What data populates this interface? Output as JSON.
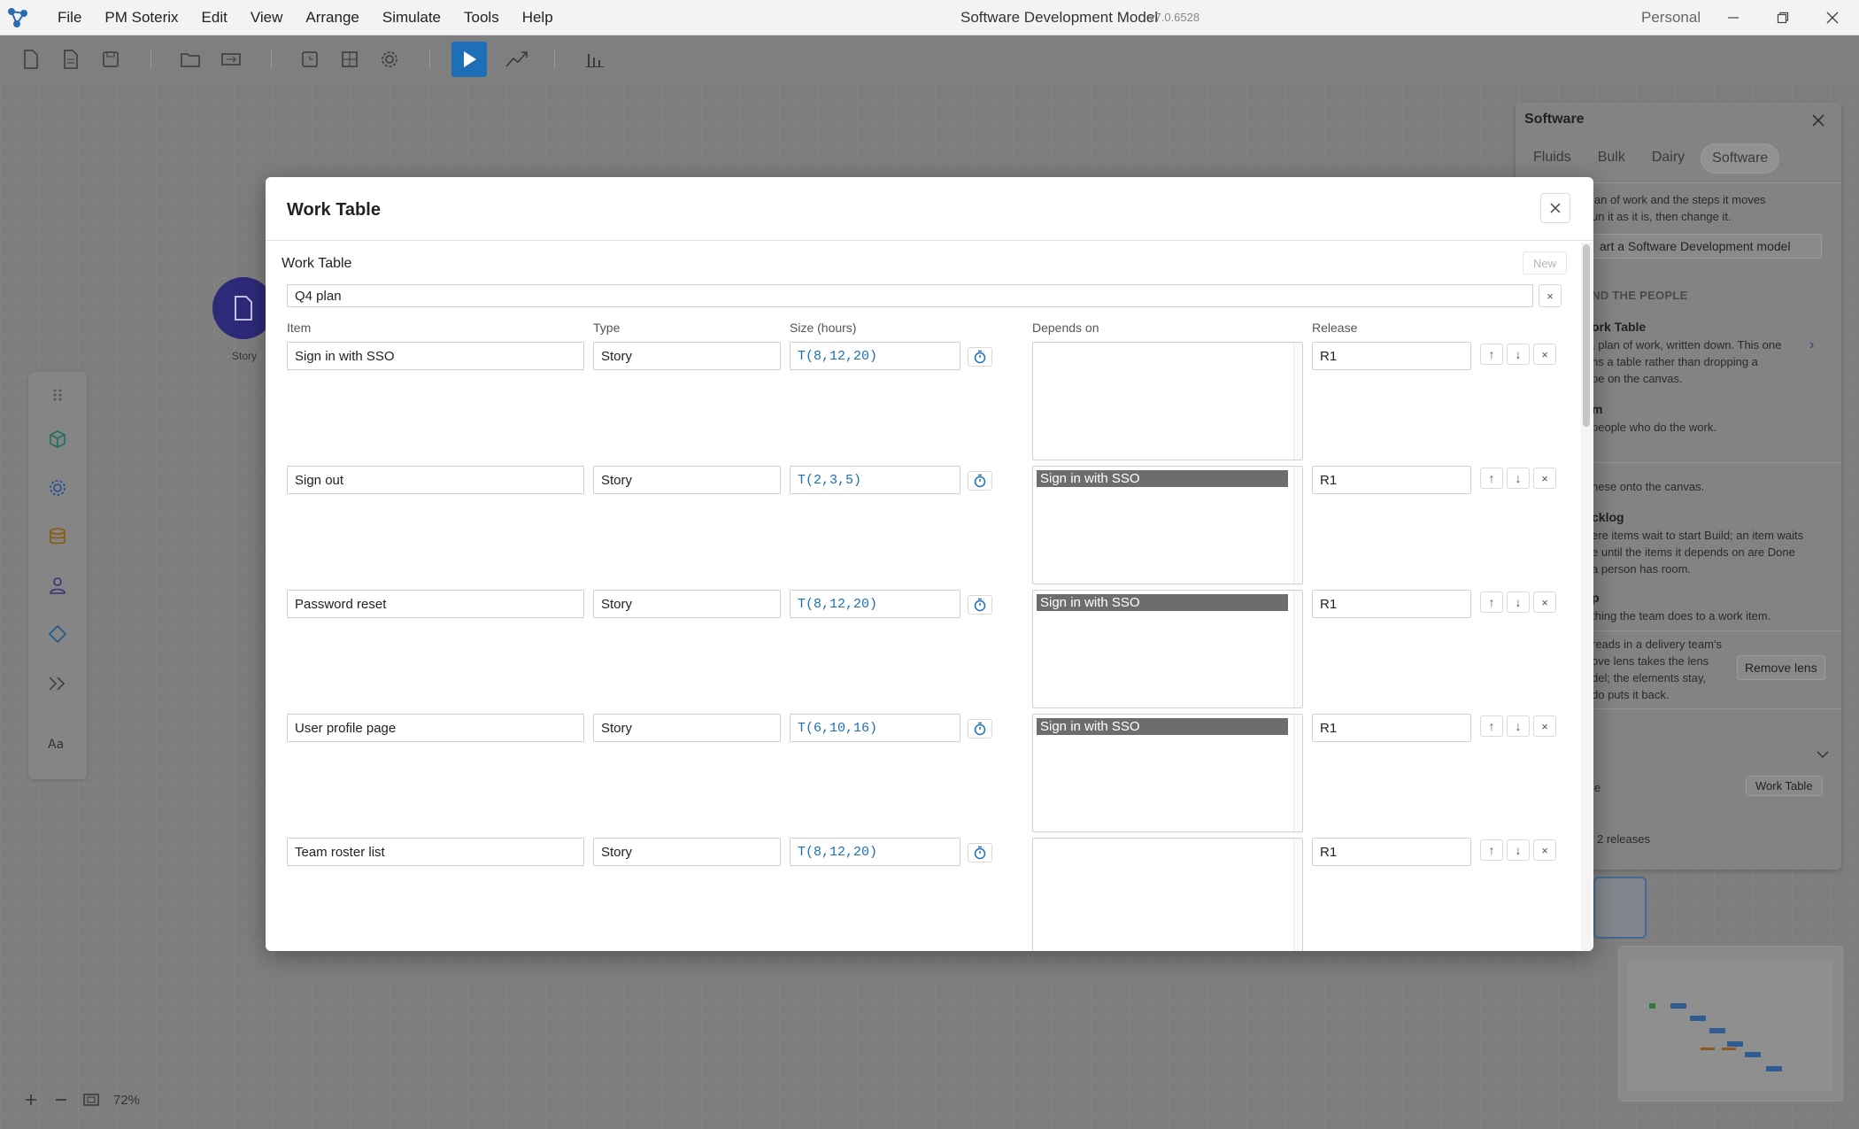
{
  "app": {
    "menu": [
      "File",
      "PM Soterix",
      "Edit",
      "View",
      "Arrange",
      "Simulate",
      "Tools",
      "Help"
    ],
    "title": "Software Development Model",
    "version": "v7.0.6528",
    "workspace": "Personal"
  },
  "canvas": {
    "story_node_label": "Story",
    "zoom_level": "72%"
  },
  "side_panel": {
    "title": "Software",
    "tabs": [
      "Fluids",
      "Bulk",
      "Dairy",
      "Software"
    ],
    "active_tab": "Software",
    "intro": [
      "lan of work and the steps it moves",
      "un it as it is, then change it."
    ],
    "start_button": "art a Software Development model",
    "section_caption": "ND THE PEOPLE",
    "work_table_head": "ork Table",
    "work_table_desc": [
      ", plan of work, written down. This one",
      "ns a table rather than dropping a",
      "pe on the canvas."
    ],
    "team_head": "m",
    "team_desc": "people who do the work.",
    "drag_hint": "hese onto the canvas.",
    "backlog_head": "cklog",
    "backlog_desc": [
      "ere items wait to start Build; an item waits",
      "e until the items it depends on are Done",
      "a person has room."
    ],
    "step_head": "p",
    "step_desc": "thing the team does to a work item.",
    "lens_desc": [
      "reads in a delivery team's",
      "ove lens takes the lens",
      "del; the elements stay,",
      "do puts it back."
    ],
    "remove_lens": "Remove lens",
    "prop_label": "le",
    "prop_value": "Work Table",
    "releases_count": "2 releases"
  },
  "dialog": {
    "title": "Work Table",
    "section_label": "Work Table",
    "new_button": "New",
    "plan_name": "Q4 plan",
    "columns": {
      "item": "Item",
      "type": "Type",
      "size": "Size (hours)",
      "depends": "Depends on",
      "release": "Release"
    },
    "rows": [
      {
        "item": "Sign in with SSO",
        "type": "Story",
        "size": "T(8,12,20)",
        "depends": "",
        "release": "R1"
      },
      {
        "item": "Sign out",
        "type": "Story",
        "size": "T(2,3,5)",
        "depends": "Sign in with SSO",
        "release": "R1"
      },
      {
        "item": "Password reset",
        "type": "Story",
        "size": "T(8,12,20)",
        "depends": "Sign in with SSO",
        "release": "R1"
      },
      {
        "item": "User profile page",
        "type": "Story",
        "size": "T(6,10,16)",
        "depends": "Sign in with SSO",
        "release": "R1"
      },
      {
        "item": "Team roster list",
        "type": "Story",
        "size": "T(8,12,20)",
        "depends": "",
        "release": "R1"
      }
    ],
    "row_buttons": {
      "up": "↑",
      "down": "↓",
      "delete": "×"
    }
  },
  "colors": {
    "accent": "#1e6fb8",
    "story_node": "#2e2a7a",
    "selected_dependency": "#6d6d6d",
    "size_text": "#1d6fb5"
  }
}
